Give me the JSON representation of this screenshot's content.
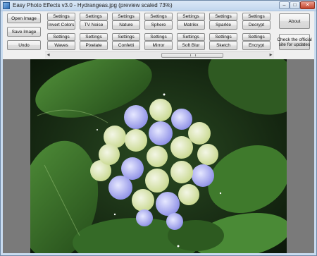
{
  "window": {
    "title": "Easy Photo Effects v3.0 - Hydrangeas.jpg (preview scaled 73%)",
    "minimize_glyph": "–",
    "maximize_glyph": "□",
    "close_glyph": "✕"
  },
  "left_buttons": {
    "open": "Open Image",
    "save": "Save Image",
    "undo": "Undo"
  },
  "effects_row1": [
    "Invert Colors",
    "TV Noise",
    "Nature",
    "Sphere",
    "Matrikx",
    "Sparkle",
    "Decrypt"
  ],
  "effects_row2": [
    "Waves",
    "Pixelate",
    "Confetti",
    "Mirror",
    "Soft Blur",
    "Sketch",
    "Encrypt"
  ],
  "settings_label": "Settings",
  "right_buttons": {
    "about": "About",
    "check_line1": "Check the official",
    "check_line2": "site for updates"
  },
  "scrollbar": {
    "left_arrow": "◀",
    "right_arrow": "▶"
  },
  "colors": {
    "window_frame": "#c9dcf0",
    "client_bg": "#f0f0f0",
    "preview_bg": "#7a7a7a"
  }
}
